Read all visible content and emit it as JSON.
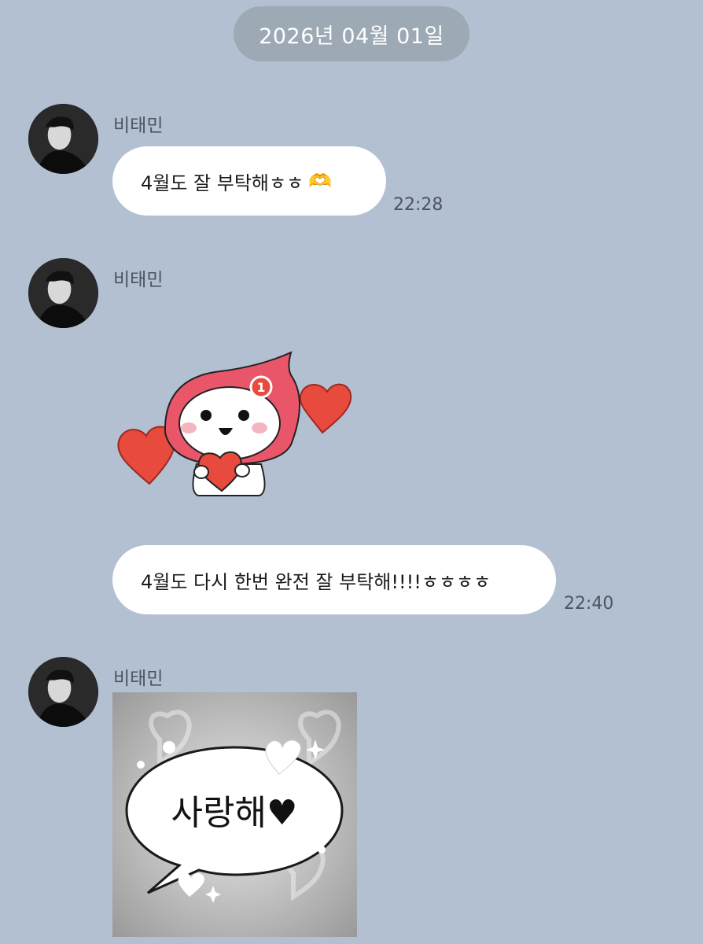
{
  "chat": {
    "date_label": "2026년 04월 01일",
    "messages": [
      {
        "sender": "비태민",
        "text": "4월도 잘 부탁해ㅎㅎ",
        "emoji": "🫶",
        "time": "22:28"
      },
      {
        "sender": "비태민",
        "sticker": "heart-character-sticker"
      },
      {
        "text": "4월도 다시 한번 완전 잘 부탁해!!!!ㅎㅎㅎㅎ",
        "time": "22:40"
      },
      {
        "sender": "비태민",
        "image_text": "사랑해♥"
      }
    ]
  },
  "colors": {
    "background": "#b2c0d1",
    "date_pill": "#9ea9b6",
    "bubble": "#ffffff",
    "sticker_red": "#e94a3e",
    "sticker_pink": "#e9566a"
  }
}
